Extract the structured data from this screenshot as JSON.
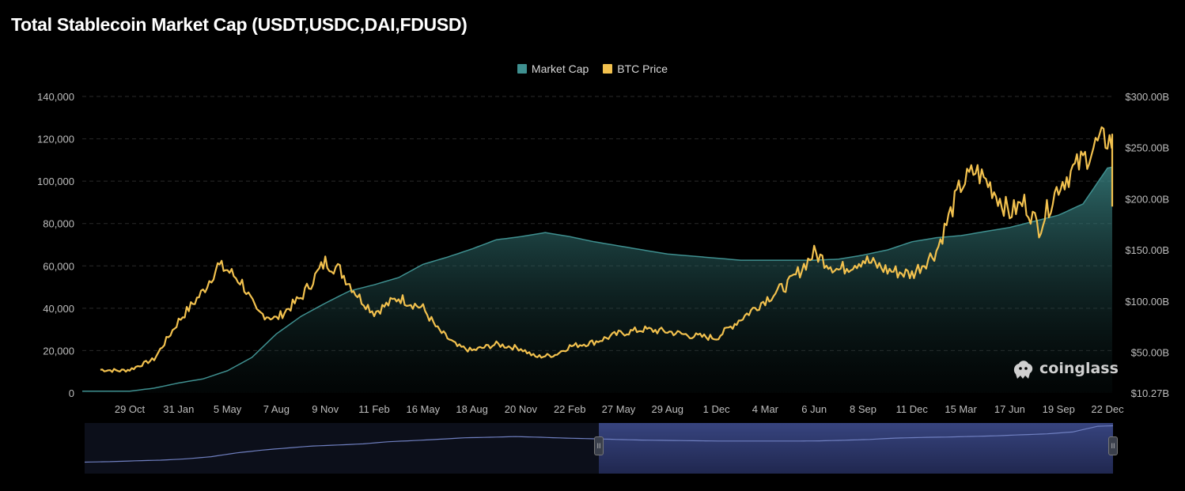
{
  "title": "Total Stablecoin Market Cap (USDT,USDC,DAI,FDUSD)",
  "legend": {
    "market_cap": {
      "label": "Market Cap",
      "color": "#3f9090"
    },
    "btc_price": {
      "label": "BTC Price",
      "color": "#f2c14e"
    }
  },
  "brand": "coinglass",
  "chart_data": {
    "type": "area",
    "x_tick_labels": [
      "29 Oct",
      "31 Jan",
      "5 May",
      "7 Aug",
      "9 Nov",
      "11 Feb",
      "16 May",
      "18 Aug",
      "20 Nov",
      "22 Feb",
      "27 May",
      "29 Aug",
      "1 Dec",
      "4 Mar",
      "6 Jun",
      "8 Sep",
      "11 Dec",
      "15 Mar",
      "17 Jun",
      "19 Sep",
      "22 Dec"
    ],
    "left_axis": {
      "ticks": [
        "0",
        "20,000",
        "40,000",
        "60,000",
        "80,000",
        "100,000",
        "120,000",
        "140,000"
      ],
      "range": [
        0,
        140000
      ]
    },
    "right_axis": {
      "ticks": [
        "$10.27B",
        "$50.00B",
        "$100.00B",
        "$150.00B",
        "$200.00B",
        "$250.00B",
        "$300.00B"
      ],
      "values": [
        10.27,
        50,
        100,
        150,
        200,
        250,
        300
      ],
      "range": [
        10.27,
        300
      ]
    },
    "series": [
      {
        "name": "Market Cap",
        "axis": "right",
        "unit": "$B",
        "x_index": [
          0,
          0.5,
          1,
          1.5,
          2,
          2.5,
          3,
          3.5,
          4,
          4.5,
          5,
          5.5,
          6,
          6.5,
          7,
          7.5,
          8,
          8.5,
          9,
          9.5,
          10,
          10.5,
          11,
          11.5,
          12,
          12.5,
          13,
          13.5,
          14,
          14.5,
          15,
          15.5,
          16,
          16.5,
          17,
          17.5,
          18,
          18.5,
          19,
          19.5,
          20,
          20.3
        ],
        "values": [
          12,
          15,
          20,
          24,
          32,
          45,
          68,
          85,
          98,
          110,
          116,
          123,
          136,
          143,
          151,
          160,
          163,
          167,
          163,
          158,
          154,
          150,
          146,
          144,
          142,
          140,
          140,
          140,
          140,
          141,
          145,
          150,
          158,
          162,
          164,
          168,
          172,
          178,
          184,
          195,
          230,
          233
        ]
      },
      {
        "name": "BTC Price",
        "axis": "left",
        "unit": "USD",
        "x_index": [
          -0.6,
          -0.2,
          0,
          0.5,
          1,
          1.5,
          1.8,
          2,
          2.3,
          2.6,
          3,
          3.5,
          4,
          4.3,
          4.7,
          5,
          5.5,
          6,
          6.3,
          6.7,
          7,
          7.5,
          8,
          8.3,
          8.7,
          9,
          9.5,
          10,
          10.5,
          11,
          11.5,
          12,
          12.5,
          13,
          13.5,
          14,
          14.5,
          15,
          15.5,
          16,
          16.5,
          17,
          17.3,
          17.6,
          18,
          18.3,
          18.6,
          19,
          19.5,
          19.8,
          20,
          20.3
        ],
        "values": [
          11000,
          10500,
          11000,
          16000,
          34000,
          48000,
          60000,
          58000,
          52000,
          38000,
          35000,
          45000,
          62000,
          58000,
          45000,
          38000,
          45000,
          40000,
          30000,
          22000,
          20000,
          23000,
          21000,
          17000,
          18000,
          22000,
          24000,
          28000,
          30000,
          29000,
          27000,
          26000,
          35000,
          44000,
          52000,
          66000,
          58000,
          63000,
          58000,
          56000,
          67000,
          98000,
          105000,
          98000,
          85000,
          90000,
          78000,
          98000,
          110000,
          118000,
          120000,
          115000,
          95000,
          87000,
          88000
        ]
      }
    ],
    "grid": true,
    "legend_position": "top-center",
    "range_selector": {
      "start_fraction": 0.5,
      "end_fraction": 1.0
    }
  }
}
